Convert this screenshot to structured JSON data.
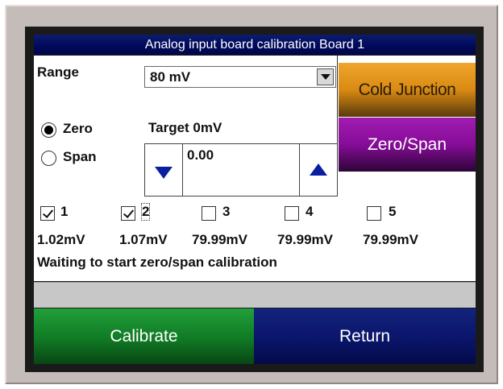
{
  "title": "Analog input board calibration Board 1",
  "range": {
    "label": "Range",
    "selected": "80 mV"
  },
  "mode": {
    "zero_label": "Zero",
    "span_label": "Span",
    "selected": "Zero"
  },
  "target": {
    "label": "Target 0mV",
    "value": "0.00"
  },
  "buttons": {
    "cold_junction": "Cold Junction",
    "zero_span": "Zero/Span",
    "calibrate": "Calibrate",
    "return": "Return"
  },
  "channels": [
    {
      "label": "1",
      "checked": true,
      "reading": "1.02mV"
    },
    {
      "label": "2",
      "checked": true,
      "reading": "1.07mV"
    },
    {
      "label": "3",
      "checked": false,
      "reading": "79.99mV"
    },
    {
      "label": "4",
      "checked": false,
      "reading": "79.99mV"
    },
    {
      "label": "5",
      "checked": false,
      "reading": "79.99mV"
    }
  ],
  "status": "Waiting to start zero/span calibration",
  "progress": 0,
  "colors": {
    "title_bar": "#00085a",
    "cold_junction": "#d98a12",
    "zero_span": "#860c98",
    "calibrate": "#107a24",
    "return": "#0a156a",
    "stepper_arrow": "#0a1fa0"
  }
}
